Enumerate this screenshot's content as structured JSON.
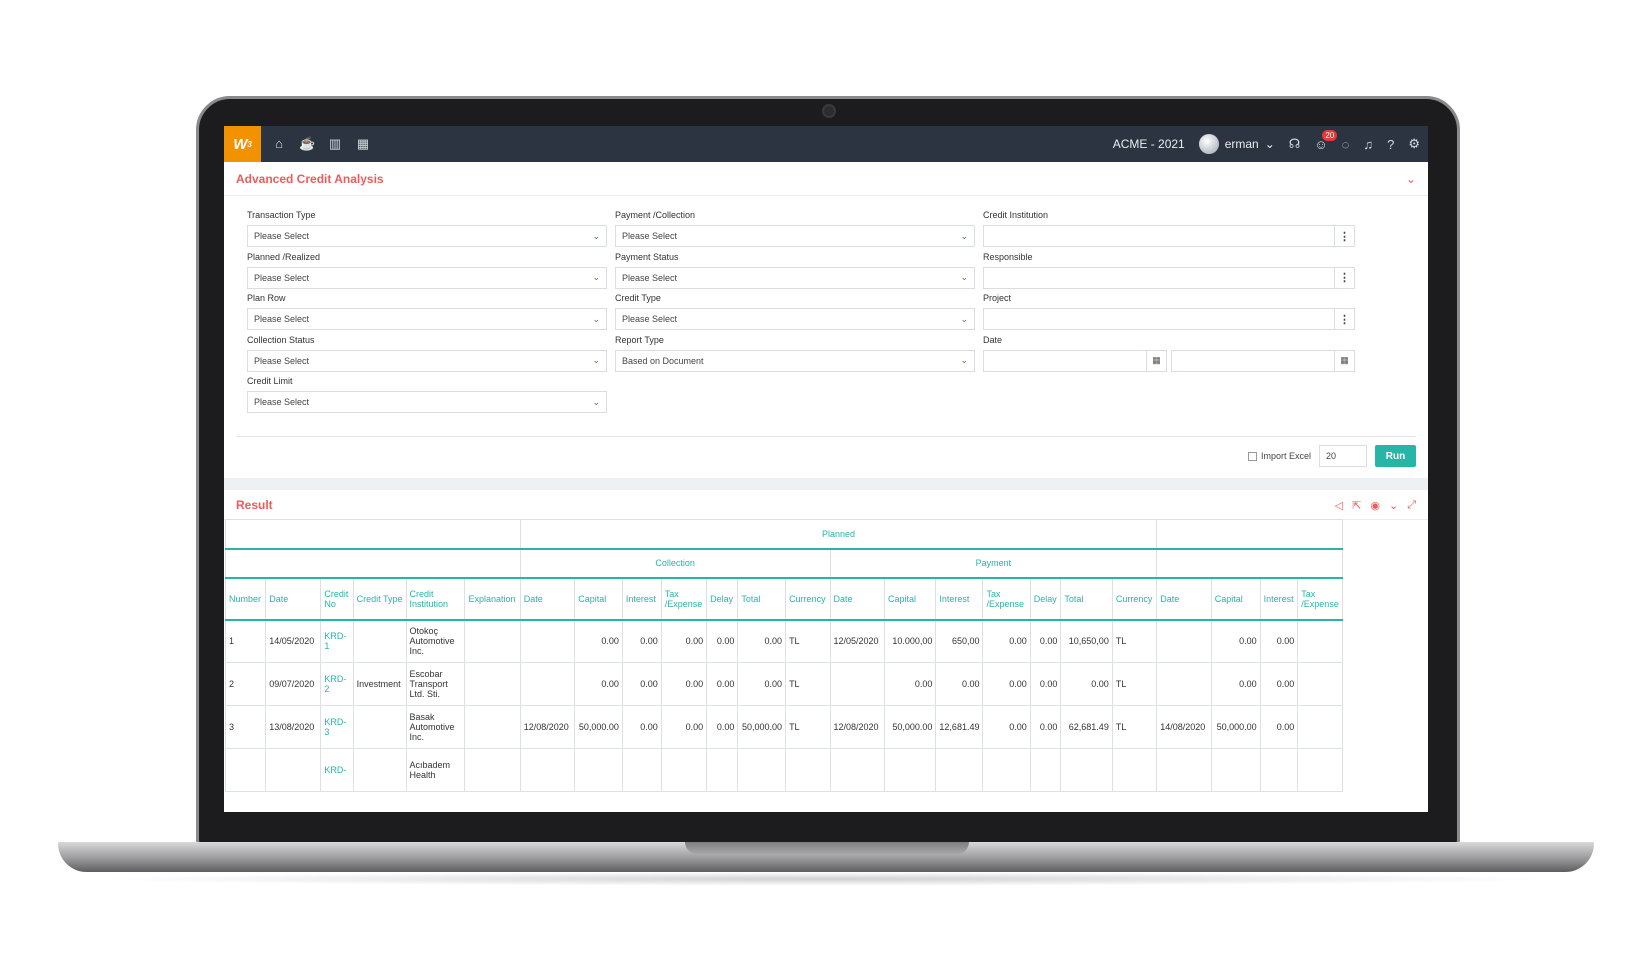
{
  "topbar": {
    "logo": "W",
    "logo_sup": "3",
    "nav_icons": [
      "home-icon",
      "coffee-icon",
      "bar-chart-icon",
      "calendar-icon"
    ],
    "company": "ACME - 2021",
    "user": "erman",
    "notification_count": "20"
  },
  "filter_panel": {
    "title": "Advanced Credit Analysis",
    "fields": {
      "transaction_type": {
        "label": "Transaction Type",
        "value": "Please Select"
      },
      "payment_collection": {
        "label": "Payment /Collection",
        "value": "Please Select"
      },
      "credit_institution": {
        "label": "Credit Institution",
        "value": ""
      },
      "planned_realized": {
        "label": "Planned /Realized",
        "value": "Please Select"
      },
      "payment_status": {
        "label": "Payment Status",
        "value": "Please Select"
      },
      "responsible": {
        "label": "Responsible",
        "value": ""
      },
      "plan_row": {
        "label": "Plan Row",
        "value": "Please Select"
      },
      "credit_type": {
        "label": "Credit Type",
        "value": "Please Select"
      },
      "project": {
        "label": "Project",
        "value": ""
      },
      "collection_status": {
        "label": "Collection Status",
        "value": "Please Select"
      },
      "report_type": {
        "label": "Report Type",
        "value": "Based on Document"
      },
      "date": {
        "label": "Date",
        "from": "",
        "to": ""
      },
      "credit_limit": {
        "label": "Credit Limit",
        "value": "Please Select"
      }
    },
    "import_excel_label": "Import Excel",
    "page_size": "20",
    "run_label": "Run"
  },
  "result": {
    "title": "Result",
    "group_top": "Planned",
    "group_collection": "Collection",
    "group_payment": "Payment",
    "columns": [
      "Number",
      "Date",
      "Credit No",
      "Credit Type",
      "Credit Institution",
      "Explanation",
      "Date",
      "Capital",
      "Interest",
      "Tax /Expense",
      "Delay",
      "Total",
      "Currency",
      "Date",
      "Capital",
      "Interest",
      "Tax /Expense",
      "Delay",
      "Total",
      "Currency",
      "Date",
      "Capital",
      "Interest",
      "Tax /Expense"
    ],
    "rows": [
      [
        "1",
        "14/05/2020",
        "KRD-1",
        "",
        "Otokoç Automotive Inc.",
        "",
        "",
        "0.00",
        "0.00",
        "0.00",
        "0.00",
        "0.00",
        "TL",
        "12/05/2020",
        "10.000,00",
        "650,00",
        "0.00",
        "0.00",
        "10,650,00",
        "TL",
        "",
        "0.00",
        "0.00",
        ""
      ],
      [
        "2",
        "09/07/2020",
        "KRD-2",
        "Investment",
        "Escobar Transport Ltd. Sti.",
        "",
        "",
        "0.00",
        "0.00",
        "0.00",
        "0.00",
        "0.00",
        "TL",
        "",
        "0.00",
        "0.00",
        "0.00",
        "0.00",
        "0.00",
        "TL",
        "",
        "0.00",
        "0.00",
        ""
      ],
      [
        "3",
        "13/08/2020",
        "KRD-3",
        "",
        "Basak Automotive Inc.",
        "",
        "12/08/2020",
        "50,000.00",
        "0.00",
        "0.00",
        "0.00",
        "50,000.00",
        "TL",
        "12/08/2020",
        "50,000.00",
        "12,681.49",
        "0.00",
        "0.00",
        "62,681.49",
        "TL",
        "14/08/2020",
        "50,000.00",
        "0.00",
        ""
      ],
      [
        "",
        "",
        "KRD-",
        "",
        "Acıbadem Health",
        "",
        "",
        "",
        "",
        "",
        "",
        "",
        "",
        "",
        "",
        "",
        "",
        "",
        "",
        "",
        "",
        "",
        "",
        ""
      ]
    ]
  }
}
